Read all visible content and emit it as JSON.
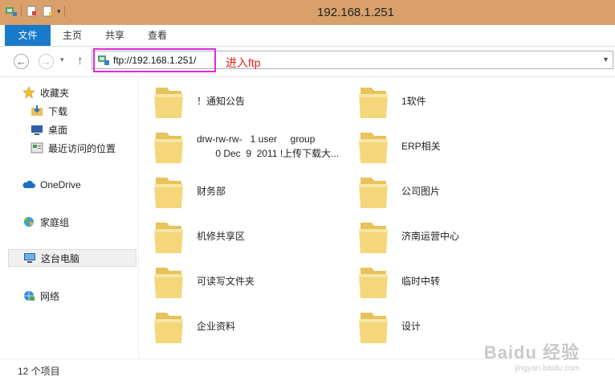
{
  "window": {
    "title": "192.168.1.251"
  },
  "ribbon": {
    "tabs": {
      "file": "文件",
      "home": "主页",
      "share": "共享",
      "view": "查看"
    }
  },
  "nav": {
    "address_value": "ftp://192.168.1.251/",
    "annotation": "进入ftp"
  },
  "sidebar": {
    "favorites": "收藏夹",
    "downloads": "下载",
    "desktop": "桌面",
    "recent": "最近访问的位置",
    "onedrive": "OneDrive",
    "homegroup": "家庭组",
    "thispc": "这台电脑",
    "network": "网络"
  },
  "folders": [
    {
      "name": "！通知公告"
    },
    {
      "name": "1软件"
    },
    {
      "name": "drw-rw-rw-   1 user     group\n       0 Dec  9  2011 !上传下载大..."
    },
    {
      "name": "ERP相关"
    },
    {
      "name": "财务部"
    },
    {
      "name": "公司图片"
    },
    {
      "name": "机修共享区"
    },
    {
      "name": "济南运营中心"
    },
    {
      "name": "可读写文件夹"
    },
    {
      "name": "临时中转"
    },
    {
      "name": "企业资料"
    },
    {
      "name": "设计"
    }
  ],
  "status": {
    "item_count": "12 个项目"
  },
  "watermark": {
    "brand": "Baidu 经验",
    "url": "jingyan.baidu.com"
  },
  "colors": {
    "titlebar": "#d9a06b",
    "file_tab": "#1979ca",
    "highlight_box": "#e12ad6",
    "annotation_text": "#e3241b",
    "folder": "#f3d77a"
  }
}
